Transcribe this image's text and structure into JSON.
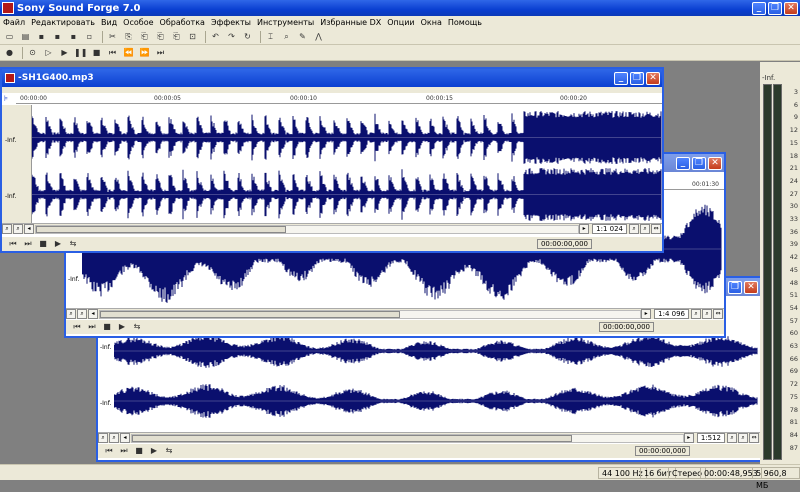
{
  "app": {
    "title": "Sony Sound Forge 7.0"
  },
  "menu": [
    "Файл",
    "Редактировать",
    "Вид",
    "Особое",
    "Обработка",
    "Эффекты",
    "Инструменты",
    "Избранные DX",
    "Опции",
    "Окна",
    "Помощь"
  ],
  "windows": {
    "front": {
      "title": "-SH1G400.mp3",
      "ruler": [
        "00:00:00",
        "00:00:05",
        "00:00:10",
        "00:00:15",
        "00:00:20"
      ],
      "channel_label": "-Inf.",
      "zoom": "1:1 024",
      "time": "00:00:00,000"
    },
    "middle": {
      "ruler_last": "00:01:30",
      "channel_label": "-Inf.",
      "zoom": "1:4 096",
      "time": "00:00:00,000"
    },
    "back": {
      "channel_label": "-Inf.",
      "zoom": "1:512",
      "time": "00:00:00,000"
    }
  },
  "meter": {
    "inf_label": "-Inf.",
    "scale": [
      "3",
      "6",
      "9",
      "12",
      "15",
      "18",
      "21",
      "24",
      "27",
      "30",
      "33",
      "36",
      "39",
      "42",
      "45",
      "48",
      "51",
      "54",
      "57",
      "60",
      "63",
      "66",
      "69",
      "72",
      "75",
      "78",
      "81",
      "84",
      "87"
    ]
  },
  "status": {
    "sample_rate": "44 100 Hz",
    "bit_depth": "16 бит",
    "channels": "Стерео",
    "length": "00:00:48,953",
    "free_space": "5 960,8 МБ"
  },
  "colors": {
    "wave": "#0a0f6e",
    "titlebar": "#0a3fd1",
    "window_bg": "#ece9d8"
  }
}
